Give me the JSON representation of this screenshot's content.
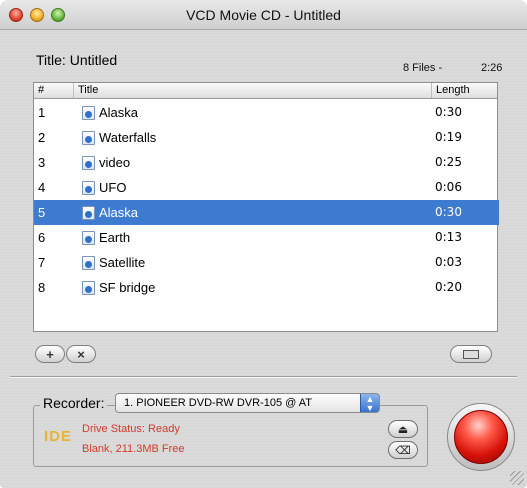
{
  "window": {
    "title": "VCD Movie CD - Untitled"
  },
  "project": {
    "title_label": "Title:",
    "title_value": "Untitled",
    "files": "8 Files -",
    "duration": "2:26"
  },
  "table": {
    "columns": [
      "#",
      "Title",
      "Length"
    ],
    "rows": [
      {
        "num": "1",
        "title": "Alaska",
        "length": "0:30"
      },
      {
        "num": "2",
        "title": "Waterfalls",
        "length": "0:19"
      },
      {
        "num": "3",
        "title": "video",
        "length": "0:25"
      },
      {
        "num": "4",
        "title": "UFO",
        "length": "0:06"
      },
      {
        "num": "5",
        "title": "Alaska",
        "length": "0:30"
      },
      {
        "num": "6",
        "title": "Earth",
        "length": "0:13"
      },
      {
        "num": "7",
        "title": "Satellite",
        "length": "0:03"
      },
      {
        "num": "8",
        "title": "SF bridge",
        "length": "0:20"
      }
    ],
    "selected_row": 5
  },
  "buttons": {
    "add": "+",
    "remove": "×",
    "eject": "⏏",
    "erase": "⌫"
  },
  "recorder": {
    "label": "Recorder:",
    "selected": "1. PIONEER DVD-RW  DVR-105 @ AT",
    "interface": "IDE",
    "status": "Drive Status: Ready",
    "media": "Blank, 211.3MB Free"
  },
  "colors": {
    "selection": "#3d7bd0",
    "status_text": "#d23b2c",
    "burn_button": "#d8140a",
    "ide_badge": "#e8b437"
  }
}
